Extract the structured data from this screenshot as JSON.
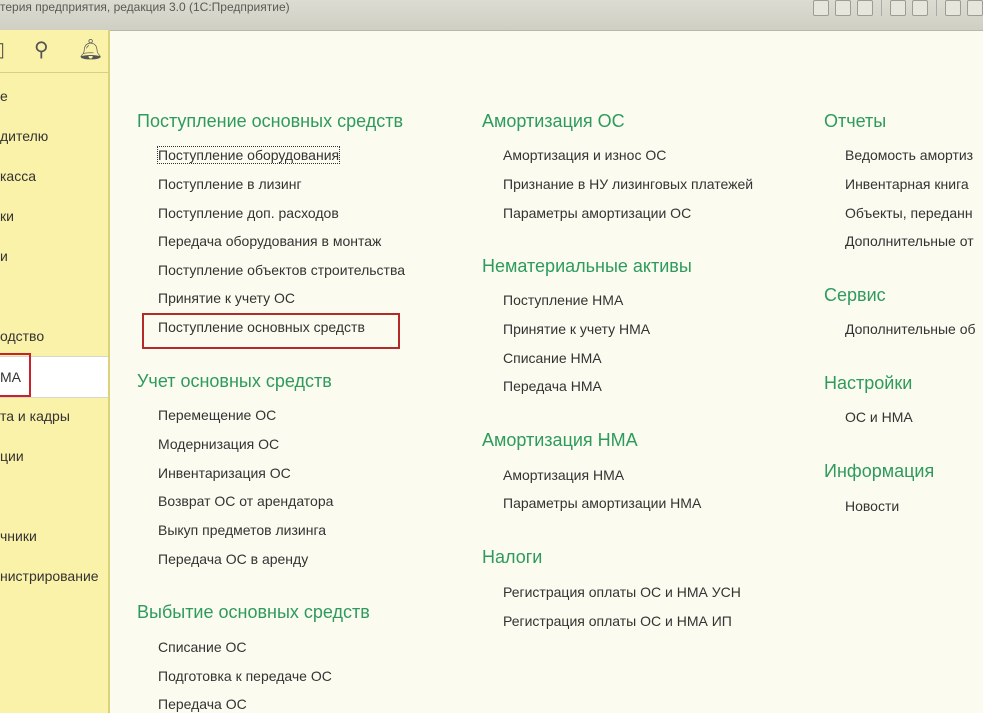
{
  "window": {
    "title": "терия предприятия, редакция 3.0  (1С:Предприятие)"
  },
  "toolbar_icons": [
    "save-icon",
    "print-icon",
    "preview-icon",
    "doc-icon",
    "doc2-icon",
    "calc-icon",
    "calendar-icon"
  ],
  "sidebar": {
    "toolbar": [
      "list-icon",
      "search-icon",
      "bell-icon"
    ],
    "items": [
      {
        "label": "е"
      },
      {
        "label": "дителю"
      },
      {
        "label": "касса"
      },
      {
        "label": "ки"
      },
      {
        "label": "и"
      },
      {
        "label": ""
      },
      {
        "label": "одство"
      },
      {
        "label": "МА"
      },
      {
        "label": "та и кадры"
      },
      {
        "label": "ции"
      },
      {
        "label": ""
      },
      {
        "label": "чники"
      },
      {
        "label": "нистрирование"
      }
    ]
  },
  "main": {
    "col1": {
      "s1_title": "Поступление основных средств",
      "s1_links": [
        "Поступление оборудования",
        "Поступление в лизинг",
        "Поступление доп. расходов",
        "Передача оборудования в монтаж",
        "Поступление объектов строительства",
        "Принятие к учету ОС",
        "Поступление основных средств"
      ],
      "s2_title": "Учет основных средств",
      "s2_links": [
        "Перемещение ОС",
        "Модернизация ОС",
        "Инвентаризация ОС",
        "Возврат ОС от арендатора",
        "Выкуп предметов лизинга",
        "Передача ОС в аренду"
      ],
      "s3_title": "Выбытие основных средств",
      "s3_links": [
        "Списание ОС",
        "Подготовка к передаче ОС",
        "Передача ОС"
      ]
    },
    "col2": {
      "s1_title": "Амортизация ОС",
      "s1_links": [
        "Амортизация и износ ОС",
        "Признание в НУ лизинговых платежей",
        "Параметры амортизации ОС"
      ],
      "s2_title": "Нематериальные активы",
      "s2_links": [
        "Поступление НМА",
        "Принятие к учету НМА",
        "Списание НМА",
        "Передача НМА"
      ],
      "s3_title": "Амортизация НМА",
      "s3_links": [
        "Амортизация НМА",
        "Параметры амортизации НМА"
      ],
      "s4_title": "Налоги",
      "s4_links": [
        "Регистрация оплаты ОС и НМА УСН",
        "Регистрация оплаты ОС и НМА ИП"
      ]
    },
    "col3": {
      "s1_title": "Отчеты",
      "s1_links": [
        "Ведомость амортиз",
        "Инвентарная книга",
        "Объекты, переданн",
        "Дополнительные от"
      ],
      "s2_title": "Сервис",
      "s2_links": [
        "Дополнительные об"
      ],
      "s3_title": "Настройки",
      "s3_links": [
        "ОС и НМА"
      ],
      "s4_title": "Информация",
      "s4_links": [
        "Новости"
      ]
    }
  }
}
